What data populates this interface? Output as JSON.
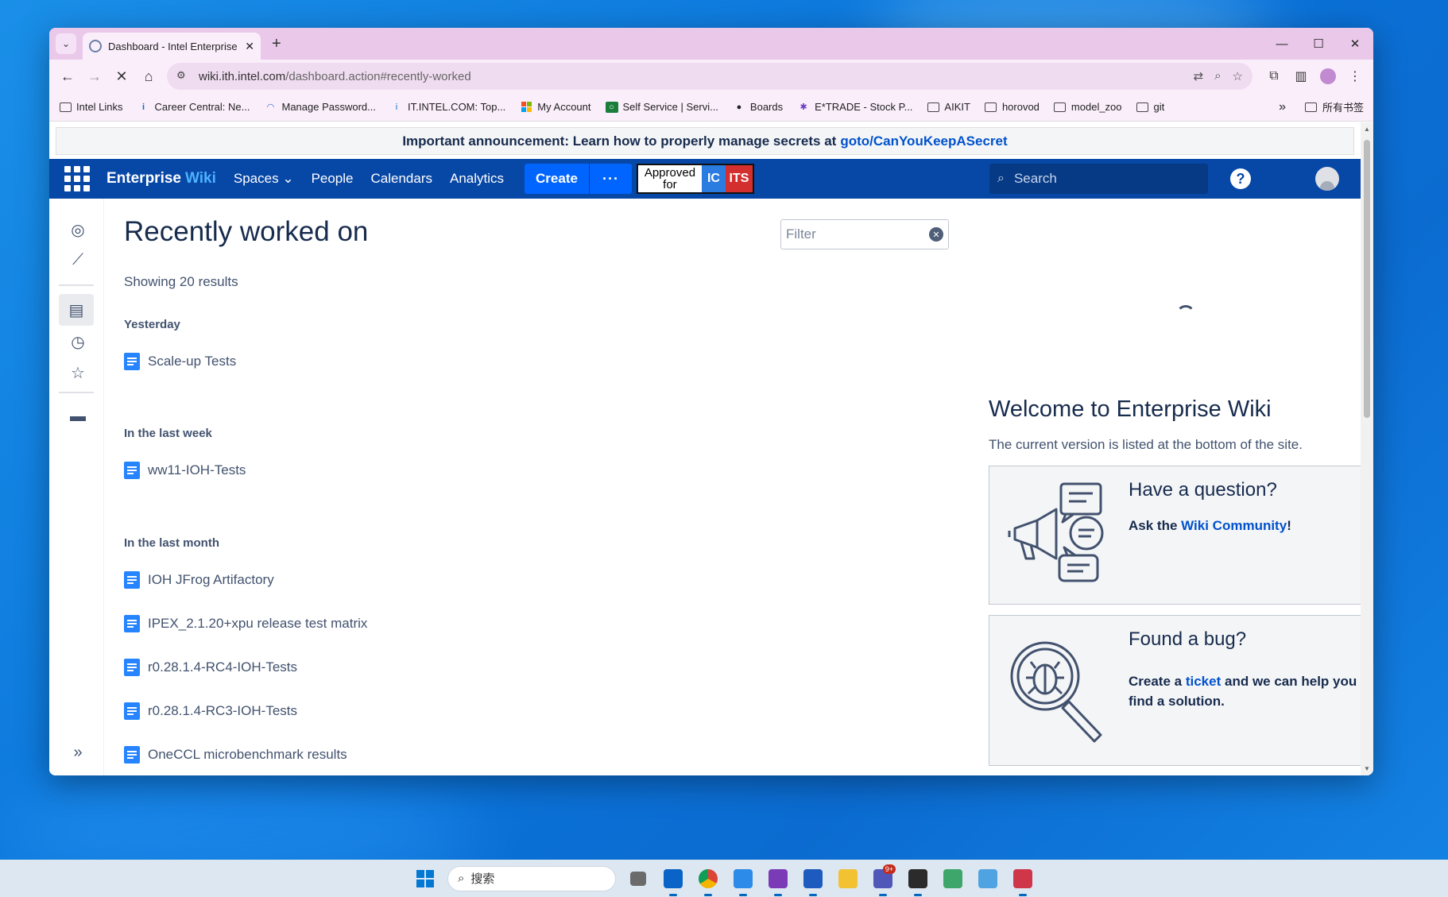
{
  "browser": {
    "tab_title": "Dashboard - Intel Enterprise",
    "url_host": "wiki.ith.intel.com",
    "url_path": "/dashboard.action#recently-worked",
    "bookmarks": [
      "Intel Links",
      "Career Central: Ne...",
      "Manage Password...",
      "IT.INTEL.COM: Top...",
      "My Account",
      "Self Service | Servi...",
      "Boards",
      "E*TRADE - Stock P...",
      "AIKIT",
      "horovod",
      "model_zoo",
      "git"
    ],
    "all_bookmarks": "所有书签"
  },
  "announcement": {
    "text": "Important announcement: Learn how to properly manage secrets at",
    "link": "goto/CanYouKeepASecret"
  },
  "nav": {
    "logo_a": "Enterprise",
    "logo_b": "Wiki",
    "spaces": "Spaces",
    "people": "People",
    "calendars": "Calendars",
    "analytics": "Analytics",
    "create": "Create",
    "more": "···",
    "approved_a": "Approved for",
    "approved_b": "IC",
    "approved_c": "ITS",
    "search_placeholder": "Search",
    "help": "?"
  },
  "main": {
    "title": "Recently worked on",
    "results": "Showing 20 results",
    "filter_placeholder": "Filter",
    "groups": {
      "yesterday": "Yesterday",
      "week": "In the last week",
      "month": "In the last month"
    },
    "items": [
      "Scale-up Tests",
      "ww11-IOH-Tests",
      "IOH JFrog Artifactory",
      "IPEX_2.1.20+xpu release test matrix",
      "r0.28.1.4-RC4-IOH-Tests",
      "r0.28.1.4-RC3-IOH-Tests",
      "OneCCL microbenchmark results"
    ]
  },
  "welcome": {
    "title": "Welcome to Enterprise Wiki",
    "subtitle": "The current version is listed at the bottom of the site.",
    "card1": {
      "title": "Have a question?",
      "pre": "Ask the",
      "link": "Wiki Community",
      "post": "!"
    },
    "card2": {
      "title": "Found a bug?",
      "pre": "Create a",
      "link": "ticket",
      "post": "and we can help you find a solution."
    }
  },
  "taskbar": {
    "search_label": "搜索",
    "teams_badge": "9+"
  },
  "colors": {
    "nav_bg": "#0747a6",
    "create_btn": "#0065ff",
    "page_icon": "#2684ff",
    "link": "#0052cc"
  }
}
